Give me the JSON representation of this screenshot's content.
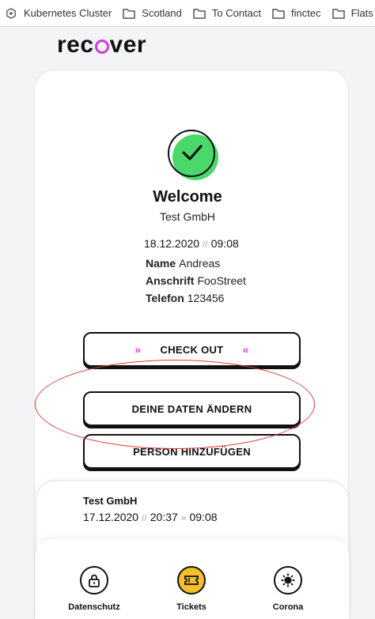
{
  "bookmarks": [
    {
      "label": "Kubernetes Cluster",
      "icon": "kubernetes-icon"
    },
    {
      "label": "Scotland",
      "icon": "folder-icon"
    },
    {
      "label": "To Contact",
      "icon": "folder-icon"
    },
    {
      "label": "finctec",
      "icon": "folder-icon"
    },
    {
      "label": "Flats",
      "icon": "folder-icon"
    }
  ],
  "logo": {
    "left": "rec",
    "right": "ver"
  },
  "status": {
    "title": "Welcome",
    "company": "Test GmbH",
    "date": "18.12.2020",
    "separator": "//",
    "time": "09:08"
  },
  "person": {
    "name_label": "Name",
    "name_value": "Andreas",
    "address_label": "Anschrift",
    "address_value": "FooStreet",
    "phone_label": "Telefon",
    "phone_value": "123456"
  },
  "buttons": {
    "checkout": "CHECK OUT",
    "change_data": "DEINE DATEN ÄNDERN",
    "add_person": "PERSON HINZUFÜGEN"
  },
  "ticket": {
    "company": "Test GmbH",
    "date": "17.12.2020",
    "separator": "//",
    "time_in": "20:37",
    "time_out": "09:08"
  },
  "nav": [
    {
      "label": "Datenschutz",
      "icon": "lock-icon"
    },
    {
      "label": "Tickets",
      "icon": "ticket-icon",
      "active": true
    },
    {
      "label": "Corona",
      "icon": "virus-icon"
    }
  ],
  "colors": {
    "accent": "#d43ad6",
    "success": "#4ad86b",
    "active_nav": "#f3bf2a",
    "annotation": "#e03a3a"
  }
}
